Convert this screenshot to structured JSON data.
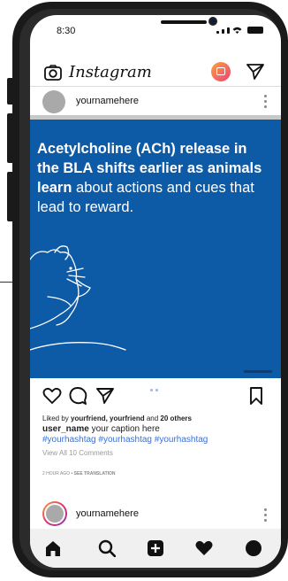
{
  "status_bar": {
    "time": "8:30"
  },
  "header": {
    "logo": "Instagram",
    "icons": [
      "camera-icon",
      "igtv-icon",
      "send-icon"
    ]
  },
  "post1": {
    "username": "yournamehere",
    "image_text_bold1": "Acetylcholine (ACh) release in the BLA shifts earlier as animals learn",
    "image_text_rest": " about actions and cues that lead to reward.",
    "likes_prefix": "Liked by ",
    "liker1": "yourfriend",
    "liker_sep": ", ",
    "liker2": "yourfriend",
    "likes_and": " and ",
    "likes_count": "20 others",
    "caption_user": "user_name",
    "caption_text": " your caption here",
    "hashtags": "#yourhashtag #yourhashtag #yourhashtag",
    "comments": "View All 10 Comments",
    "time_ago": "2 HOUR AGO",
    "translate_sep": " • ",
    "translate": "SEE TRANSLATION"
  },
  "post2": {
    "username": "yournamehere"
  },
  "bottom_nav": [
    "home-icon",
    "search-icon",
    "add-icon",
    "heart-icon",
    "profile-icon"
  ],
  "colors": {
    "image_bg": "#0d5aa7",
    "hashtag": "#3b6fd6",
    "igtv_start": "#f9a23b",
    "igtv_end": "#f0407a"
  }
}
